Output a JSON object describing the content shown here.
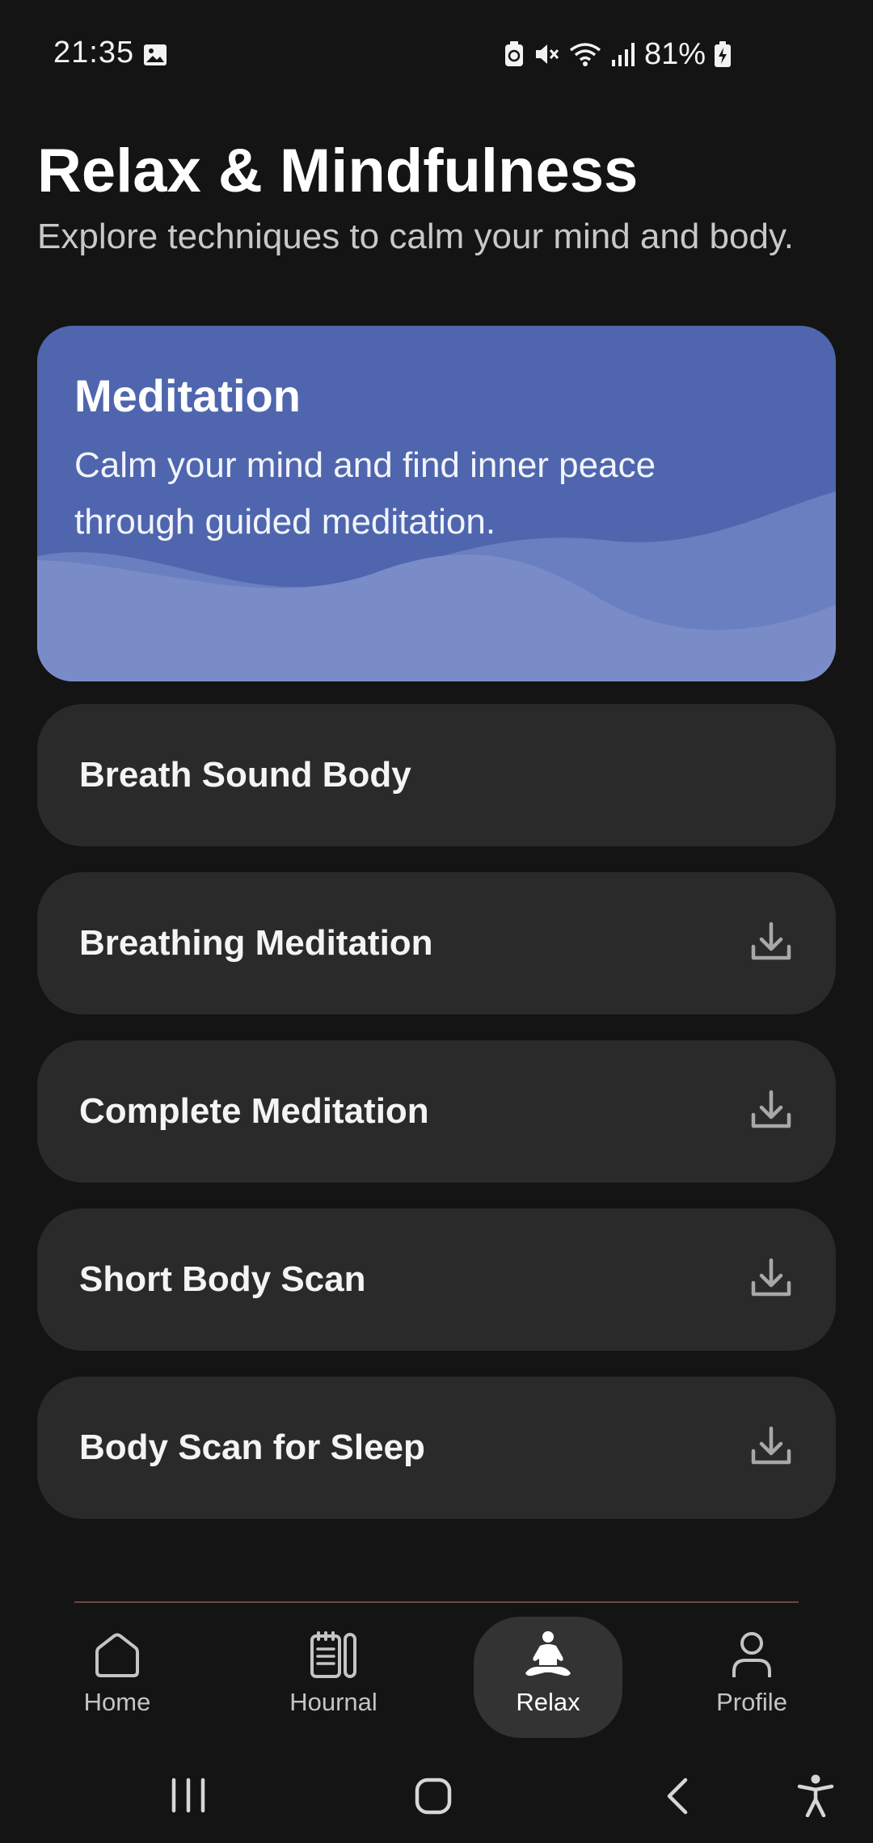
{
  "status_bar": {
    "time": "21:35",
    "battery": "81%",
    "icons": [
      "image-icon",
      "battery-saver-icon",
      "mute-icon",
      "wifi-icon",
      "signal-icon",
      "battery-charging-icon"
    ]
  },
  "header": {
    "title": "Relax & Mindfulness",
    "subtitle": "Explore techniques to calm your mind and body."
  },
  "hero": {
    "title": "Meditation",
    "description": "Calm your mind and find inner peace through guided meditation."
  },
  "meditations": [
    {
      "label": "Breath Sound Body",
      "download": false
    },
    {
      "label": "Breathing Meditation",
      "download": true
    },
    {
      "label": "Complete Meditation",
      "download": true
    },
    {
      "label": "Short Body Scan",
      "download": true
    },
    {
      "label": "Body Scan for Sleep",
      "download": true
    }
  ],
  "bottom_nav": {
    "items": [
      {
        "label": "Home",
        "icon": "home-icon",
        "active": false
      },
      {
        "label": "Hournal",
        "icon": "journal-icon",
        "active": false
      },
      {
        "label": "Relax",
        "icon": "meditation-icon",
        "active": true
      },
      {
        "label": "Profile",
        "icon": "profile-icon",
        "active": false
      }
    ]
  },
  "colors": {
    "background": "#141414",
    "card": "#2a2a2a",
    "hero": "#4f66ae",
    "active_nav": "#333333"
  }
}
